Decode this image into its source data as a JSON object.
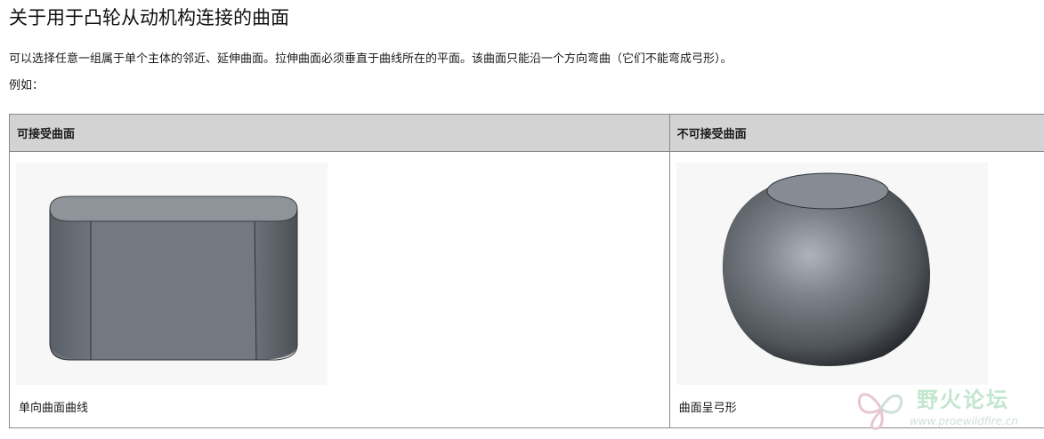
{
  "title": "关于用于凸轮从动机构连接的曲面",
  "description": "可以选择任意一组属于单个主体的邻近、延伸曲面。拉伸曲面必须垂直于曲线所在的平面。该曲面只能沿一个方向弯曲（它们不能弯成弓形）。",
  "example_label": "例如：",
  "table": {
    "headers": [
      "可接受曲面",
      "不可接受曲面"
    ],
    "captions": [
      "单向曲面曲线",
      "曲面呈弓形"
    ]
  },
  "watermark": {
    "text": "野火论坛",
    "url": "www.proewildfire.cn"
  },
  "colors": {
    "header_bg": "#d3d3d3",
    "border": "#8a8a8a",
    "surface_gray": "#6b7178",
    "watermark_green": "#c3e6cf"
  }
}
